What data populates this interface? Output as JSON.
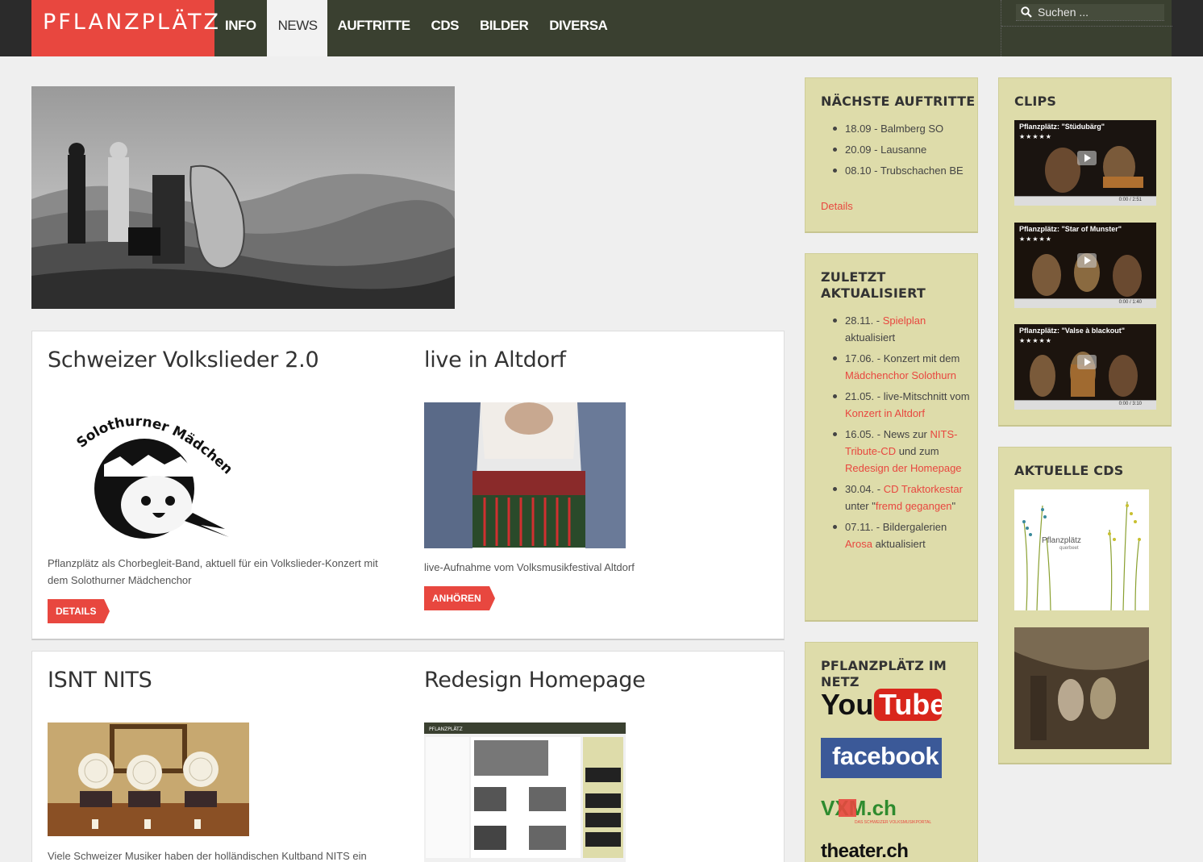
{
  "site": {
    "logo": "PFLANZPLÄTZ",
    "nav": [
      "INFO",
      "NEWS",
      "AUFTRITTE",
      "CDS",
      "BILDER",
      "DIVERSA"
    ],
    "active_nav": "NEWS",
    "search_placeholder": "Suchen ..."
  },
  "posts": [
    {
      "title": "Schweizer Volkslieder 2.0",
      "image_text": "Solothurner Mädchenchor",
      "text": "Pflanzplätz als Chorbegleit-Band, aktuell für ein Volkslieder-Konzert mit dem Solothurner Mädchenchor",
      "button": "DETAILS"
    },
    {
      "title": "live in Altdorf",
      "text": "live-Aufnahme vom Volksmusikfestival Altdorf",
      "button": "ANHÖREN"
    },
    {
      "title": "ISNT NITS",
      "text": "Viele Schweizer Musiker haben der holländischen Kultband NITS ein"
    },
    {
      "title": "Redesign Homepage",
      "image_text": "PFLANZPLÄTZ"
    }
  ],
  "widgets": {
    "next_gigs": {
      "title": "NÄCHSTE AUFTRITTE",
      "items": [
        "18.09 - Balmberg SO",
        "20.09 - Lausanne",
        "08.10 - Trubschachen BE"
      ],
      "link": "Details"
    },
    "updated": {
      "title_line1": "ZULETZT",
      "title_line2": "AKTUALISIERT",
      "items": [
        {
          "pre": "28.11. - ",
          "link": "Spielplan",
          "post": " aktualisiert"
        },
        {
          "pre": "17.06. - Konzert mit dem ",
          "link": "Mädchenchor Solothurn",
          "post": ""
        },
        {
          "pre": "21.05. - live-Mitschnitt vom ",
          "link": "Konzert in Altdorf",
          "post": ""
        },
        {
          "pre": "16.05. - News zur ",
          "link": "NITS-Tribute-CD",
          "mid": " und zum ",
          "link2": "Redesign der Homepage",
          "post": ""
        },
        {
          "pre": "30.04. - ",
          "link": "CD Traktorkestar",
          "mid": " unter \"",
          "link2": "fremd gegangen",
          "post": "\""
        },
        {
          "pre": "07.11. - Bildergalerien ",
          "link": "Arosa",
          "post": " aktualisiert"
        }
      ]
    },
    "net": {
      "title": "PFLANZPLÄTZ IM NETZ",
      "youtube": "YouTube",
      "youtube_you": "You",
      "youtube_tube": "Tube",
      "facebook": "facebook",
      "vxm": "VXM.ch",
      "vxm_sub": "DAS SCHWEIZER VOLKSMUSIKPORTAL",
      "theater": "theater.ch"
    },
    "clips": {
      "title": "CLIPS",
      "items": [
        {
          "title": "Pflanzplätz: \"Stüdubärg\"",
          "time": "0:00 / 2:51"
        },
        {
          "title": "Pflanzplätz: \"Star of Munster\"",
          "time": "0:00 / 1:40"
        },
        {
          "title": "Pflanzplätz: \"Valse à blackout\"",
          "time": "0:00 / 3:10"
        }
      ],
      "stars": "★★★★★"
    },
    "cds": {
      "title": "AKTUELLE CDS",
      "cd1_title": "Pflanzplätz",
      "cd1_sub": "querbeet"
    }
  },
  "colors": {
    "accent": "#e8473f",
    "header": "#3a4030",
    "widget_bg": "#dedcaa"
  }
}
